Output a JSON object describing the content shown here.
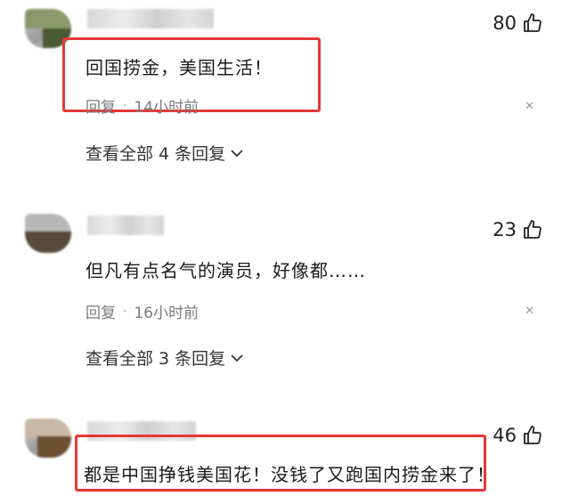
{
  "comments": [
    {
      "likes": "80",
      "text": "回国捞金，美国生活！",
      "reply_label": "回复",
      "separator": "·",
      "time": "14小时前",
      "view_replies": "查看全部 4 条回复",
      "highlighted": true
    },
    {
      "likes": "23",
      "text": "但凡有点名气的演员，好像都……",
      "reply_label": "回复",
      "separator": "·",
      "time": "16小时前",
      "view_replies": "查看全部 3 条回复",
      "highlighted": false
    },
    {
      "likes": "46",
      "text": "都是中国挣钱美国花！没钱了又跑国内捞金来了！",
      "highlighted": true
    }
  ],
  "icons": {
    "like": "thumbs-up-icon",
    "close": "close-icon",
    "expand": "chevron-down-icon"
  },
  "colors": {
    "highlight": "#e53935",
    "meta_text": "#7a7a7a"
  }
}
